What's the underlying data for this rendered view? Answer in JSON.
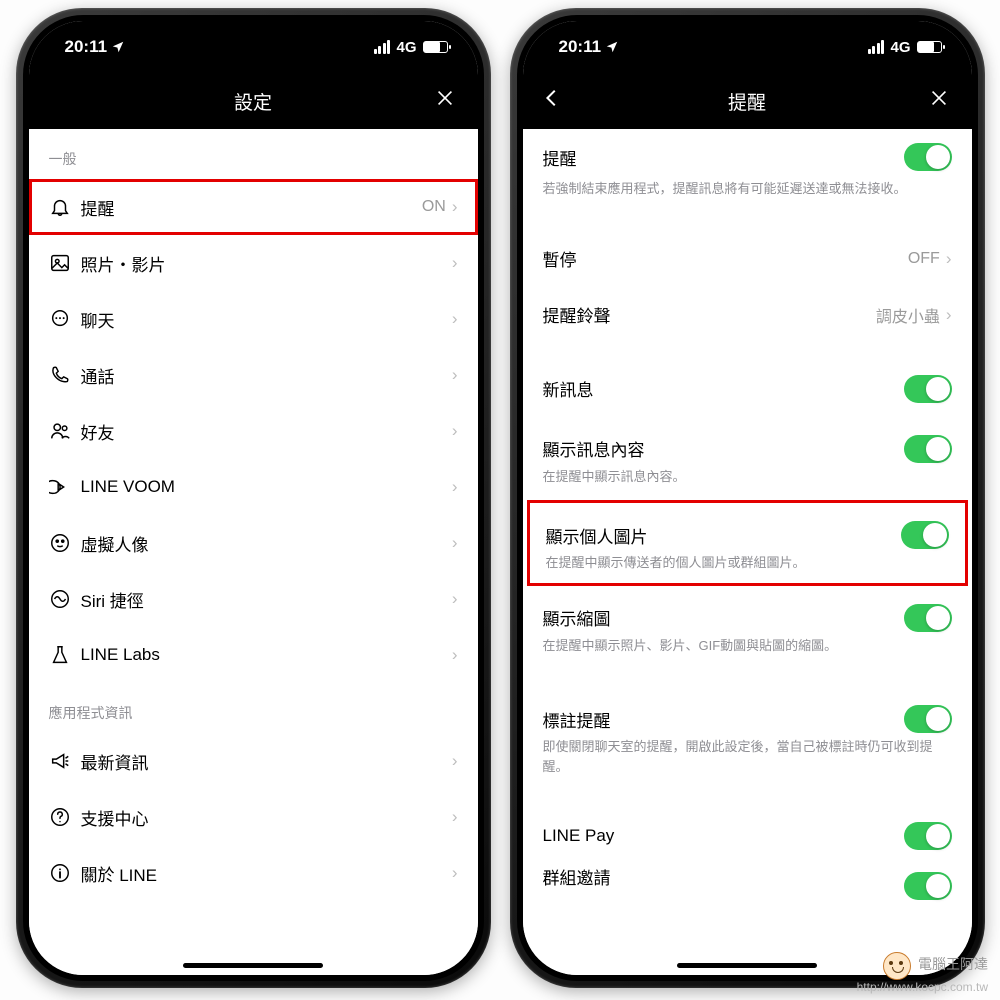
{
  "status": {
    "time": "20:11",
    "network": "4G"
  },
  "left": {
    "title": "設定",
    "section1": "一般",
    "rows": [
      {
        "label": "提醒",
        "value": "ON"
      },
      {
        "label": "照片・影片"
      },
      {
        "label": "聊天"
      },
      {
        "label": "通話"
      },
      {
        "label": "好友"
      },
      {
        "label": "LINE VOOM"
      },
      {
        "label": "虛擬人像"
      },
      {
        "label": "Siri 捷徑"
      },
      {
        "label": "LINE Labs"
      }
    ],
    "section2": "應用程式資訊",
    "rows2": [
      {
        "label": "最新資訊"
      },
      {
        "label": "支援中心"
      },
      {
        "label": "關於 LINE"
      }
    ]
  },
  "right": {
    "title": "提醒",
    "r_notify": {
      "label": "提醒",
      "desc": "若強制結束應用程式，提醒訊息將有可能延遲送達或無法接收。"
    },
    "r_pause": {
      "label": "暫停",
      "value": "OFF"
    },
    "r_sound": {
      "label": "提醒鈴聲",
      "value": "調皮小蟲"
    },
    "r_newmsg": {
      "label": "新訊息"
    },
    "r_content": {
      "label": "顯示訊息內容",
      "desc": "在提醒中顯示訊息內容。"
    },
    "r_avatar": {
      "label": "顯示個人圖片",
      "desc": "在提醒中顯示傳送者的個人圖片或群組圖片。"
    },
    "r_thumb": {
      "label": "顯示縮圖",
      "desc": "在提醒中顯示照片、影片、GIF動圖與貼圖的縮圖。"
    },
    "r_mention": {
      "label": "標註提醒",
      "desc": "即使關閉聊天室的提醒，開啟此設定後，當自己被標註時仍可收到提醒。"
    },
    "r_linepay": {
      "label": "LINE Pay"
    },
    "r_cut": {
      "label": "群組邀請"
    }
  },
  "watermark": {
    "t1": "電腦王阿達",
    "t2": "http://www.kocpc.com.tw"
  }
}
